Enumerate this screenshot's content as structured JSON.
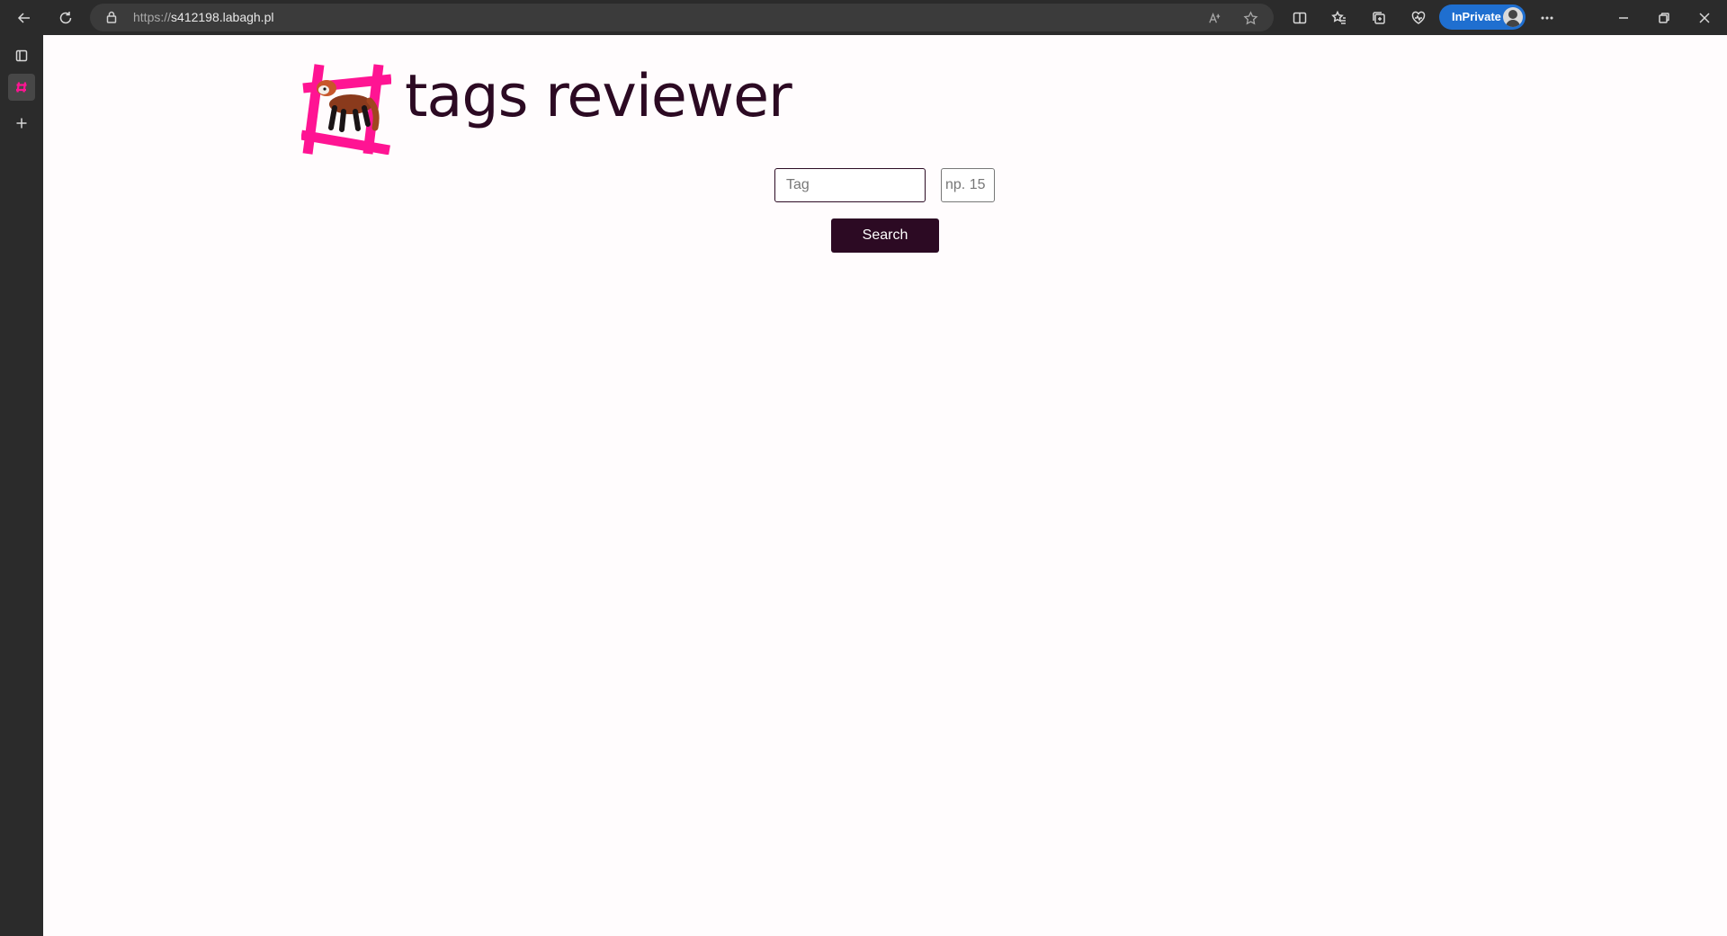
{
  "browser": {
    "url_scheme": "https://",
    "url_host": "s412198.labagh.pl",
    "inprivate_label": "InPrivate",
    "icons": [
      "back-icon",
      "refresh-icon",
      "lock-icon",
      "read-aloud-icon",
      "favorite-star-icon",
      "split-screen-icon",
      "favorites-icon",
      "collections-icon",
      "browser-essentials-icon",
      "more-icon",
      "minimize-icon",
      "restore-icon",
      "close-icon"
    ]
  },
  "sidebar": {
    "icons": [
      "tab-actions-icon",
      "site-tab-icon",
      "new-tab-icon"
    ]
  },
  "page": {
    "title": "tags reviewer",
    "tag_placeholder": "Tag",
    "count_placeholder": "np. 15",
    "search_label": "Search"
  },
  "colors": {
    "brand": "#2c0a23",
    "logo_pink": "#ff1493",
    "page_background": "#fffcfd",
    "chrome": "#2b2b2b",
    "inprivate": "#1f6fd0"
  }
}
